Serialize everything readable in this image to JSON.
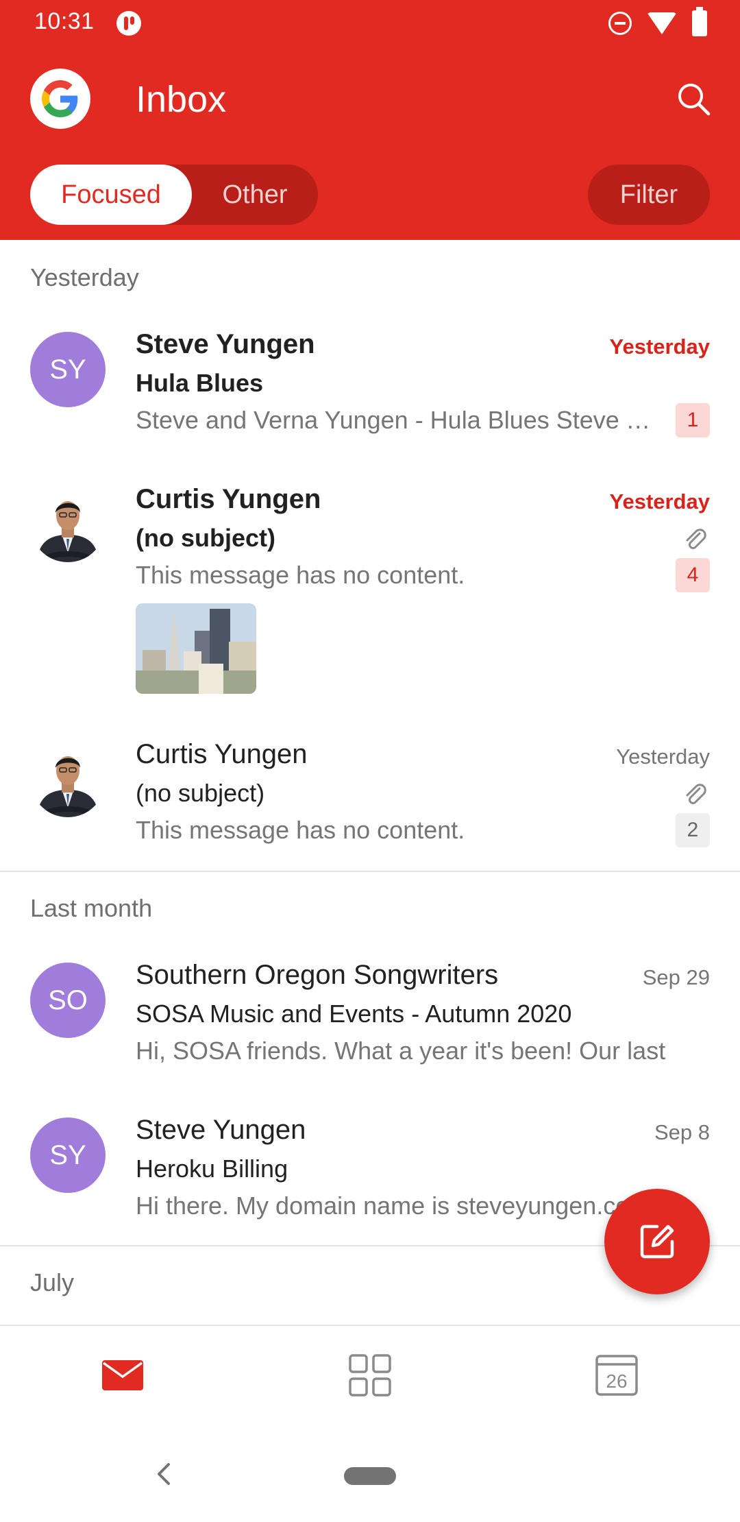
{
  "status_bar": {
    "time": "10:31"
  },
  "header": {
    "title": "Inbox",
    "tabs": [
      {
        "label": "Focused",
        "selected": true
      },
      {
        "label": "Other",
        "selected": false
      }
    ],
    "filter_label": "Filter"
  },
  "sections": [
    {
      "label": "Yesterday",
      "messages": [
        {
          "avatar_initials": "SY",
          "sender": "Steve Yungen",
          "subject": "Hula Blues",
          "preview": "Steve and Verna Yungen - Hula Blues Steve Yungen",
          "date": "Yesterday",
          "count": "1",
          "unread": true,
          "attachment": false
        },
        {
          "avatar_initials": "",
          "sender": "Curtis Yungen",
          "subject": "(no subject)",
          "preview": "This message has no content.",
          "date": "Yesterday",
          "count": "4",
          "unread": true,
          "attachment": true,
          "has_thumbnail": true
        },
        {
          "avatar_initials": "",
          "sender": "Curtis Yungen",
          "subject": "(no subject)",
          "preview": "This message has no content.",
          "date": "Yesterday",
          "count": "2",
          "unread": false,
          "attachment": true
        }
      ]
    },
    {
      "label": "Last month",
      "messages": [
        {
          "avatar_initials": "SO",
          "sender": "Southern Oregon Songwriters",
          "subject": "SOSA Music and Events - Autumn 2020",
          "preview": "Hi, SOSA friends. What a year it's been! Our last",
          "date": "Sep 29",
          "unread": false
        },
        {
          "avatar_initials": "SY",
          "sender": "Steve Yungen",
          "subject": "Heroku Billing",
          "preview": "Hi there. My domain name is steveyungen.com",
          "date": "Sep 8",
          "unread": false
        }
      ]
    },
    {
      "label": "July"
    }
  ],
  "bottom_nav": {
    "calendar_day": "26"
  },
  "colors": {
    "brand_red": "#E12A21",
    "avatar_purple": "#A07DDA",
    "unread_badge_bg": "#FBD7D5"
  },
  "icons": [
    "google-icon",
    "search-icon",
    "attachment-icon",
    "compose-icon",
    "mail-icon",
    "apps-grid-icon",
    "calendar-icon",
    "back-icon"
  ]
}
